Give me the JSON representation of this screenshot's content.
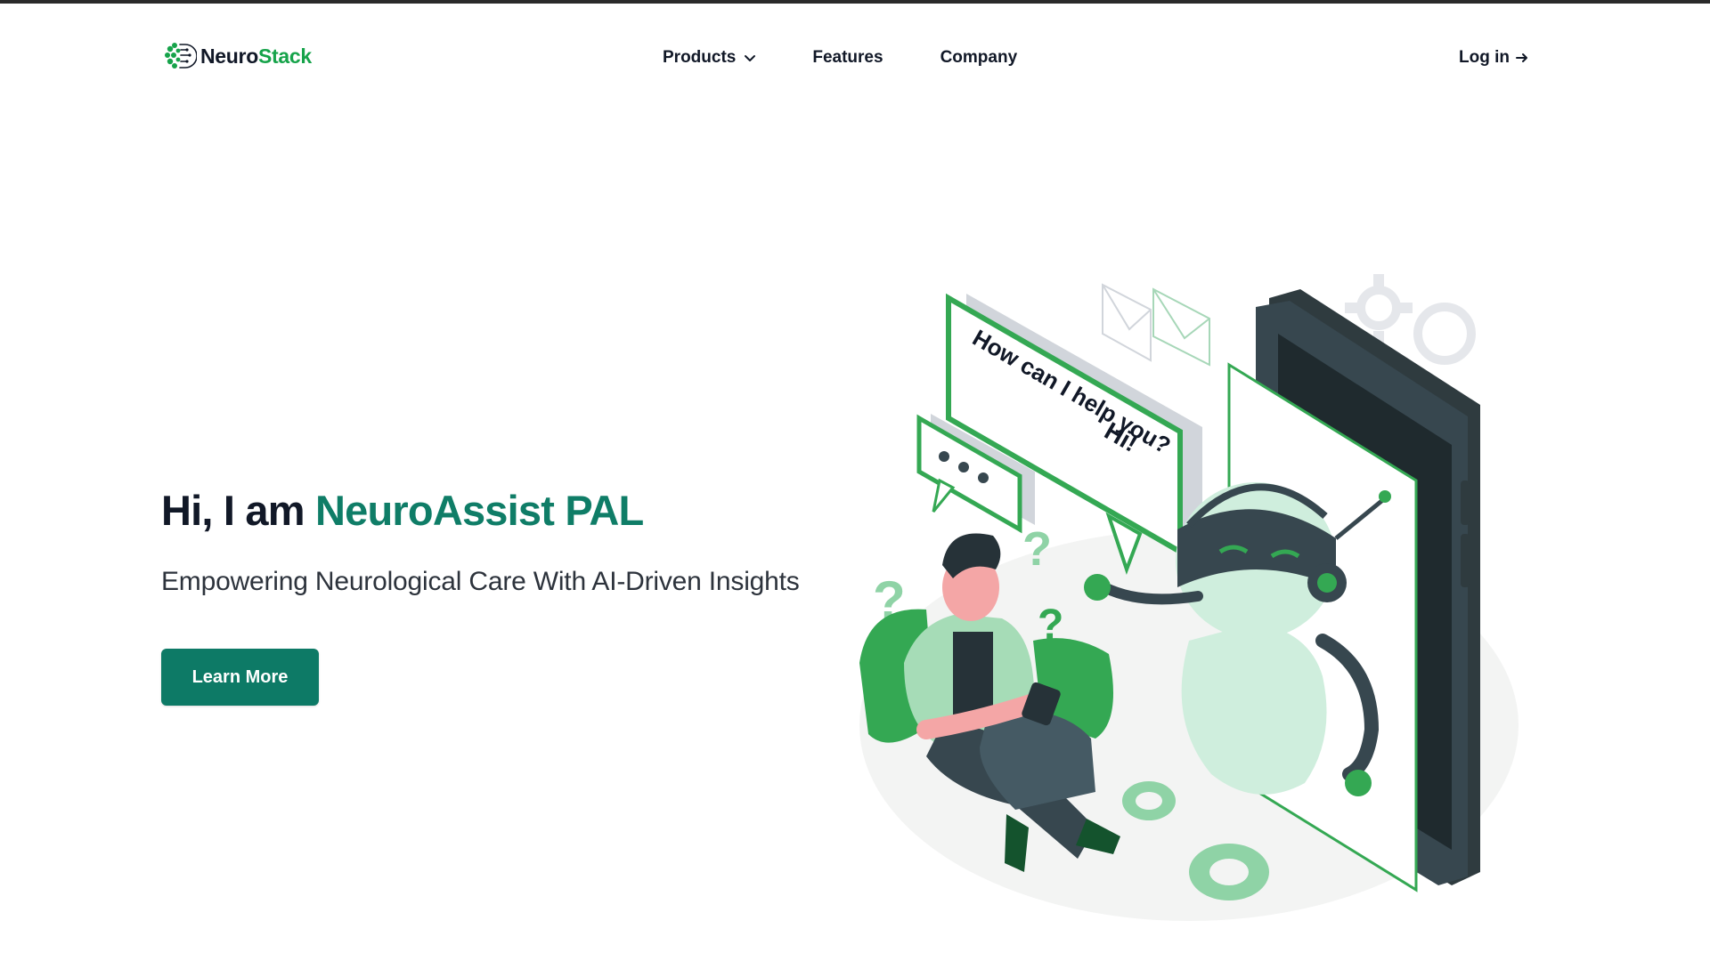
{
  "top_strip_color": "#2a2a2a",
  "header": {
    "logo": {
      "name_part1": "Neuro",
      "name_part2": "Stack",
      "icon": "brain-circuit-icon"
    },
    "nav": [
      {
        "label": "Products",
        "has_dropdown": true,
        "icon": "chevron-down-icon"
      },
      {
        "label": "Features"
      },
      {
        "label": "Company"
      }
    ],
    "login": {
      "label": "Log in",
      "icon": "arrow-right-icon"
    }
  },
  "hero": {
    "title_prefix": "Hi, I am ",
    "title_brand": "NeuroAssist PAL",
    "subtitle": "Empowering Neurological Care With AI-Driven Insights",
    "cta_label": "Learn More"
  },
  "illustration": {
    "speech_bubble_line1": "Hi!",
    "speech_bubble_line2": "How can I help you?",
    "description_icon": "robot-chat-illustration"
  },
  "colors": {
    "brand_teal": "#0f7d67",
    "button_teal": "#0d7a66",
    "accent_green": "#16a34a",
    "illustration_green": "#34a853",
    "dark_text": "#111827"
  }
}
